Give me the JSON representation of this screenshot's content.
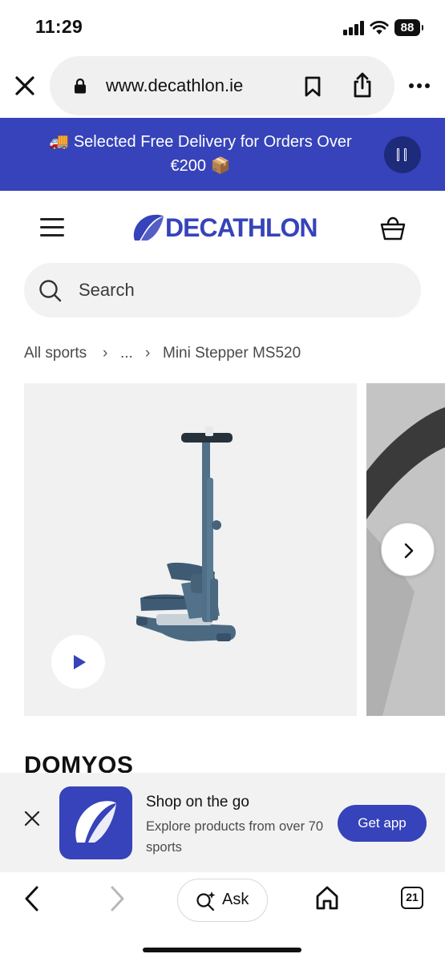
{
  "status_bar": {
    "time": "11:29",
    "battery": "88",
    "icons": [
      "signal-icon",
      "wifi-icon",
      "battery-icon"
    ]
  },
  "browser": {
    "url": "www.decathlon.ie",
    "icons": [
      "close-icon",
      "lock-icon",
      "bookmark-icon",
      "share-icon",
      "more-icon"
    ]
  },
  "promo_banner": {
    "text": "🚚 Selected Free Delivery for Orders Over €200 📦",
    "background": "#3643ba",
    "pause_icon": "pause-icon"
  },
  "header": {
    "logo_text": "DECATHLON",
    "brand_color": "#3643ba",
    "icons": [
      "menu-icon",
      "basket-icon"
    ]
  },
  "search": {
    "placeholder": "Search"
  },
  "breadcrumb": {
    "items": [
      "All sports",
      "...",
      "Mini Stepper MS520"
    ]
  },
  "gallery": {
    "image_description_icon": "stepper-product-image",
    "controls": [
      "play-icon",
      "chevron-right-icon"
    ]
  },
  "product": {
    "brand": "DOMYOS"
  },
  "app_banner": {
    "title": "Shop on the go",
    "description": "Explore products from over 70 sports",
    "button": "Get app"
  },
  "toolbar": {
    "ask_label": "Ask",
    "tabs_count": "21",
    "icons": [
      "back-icon",
      "forward-icon",
      "sparkle-search-icon",
      "home-icon",
      "tabs-icon"
    ]
  }
}
